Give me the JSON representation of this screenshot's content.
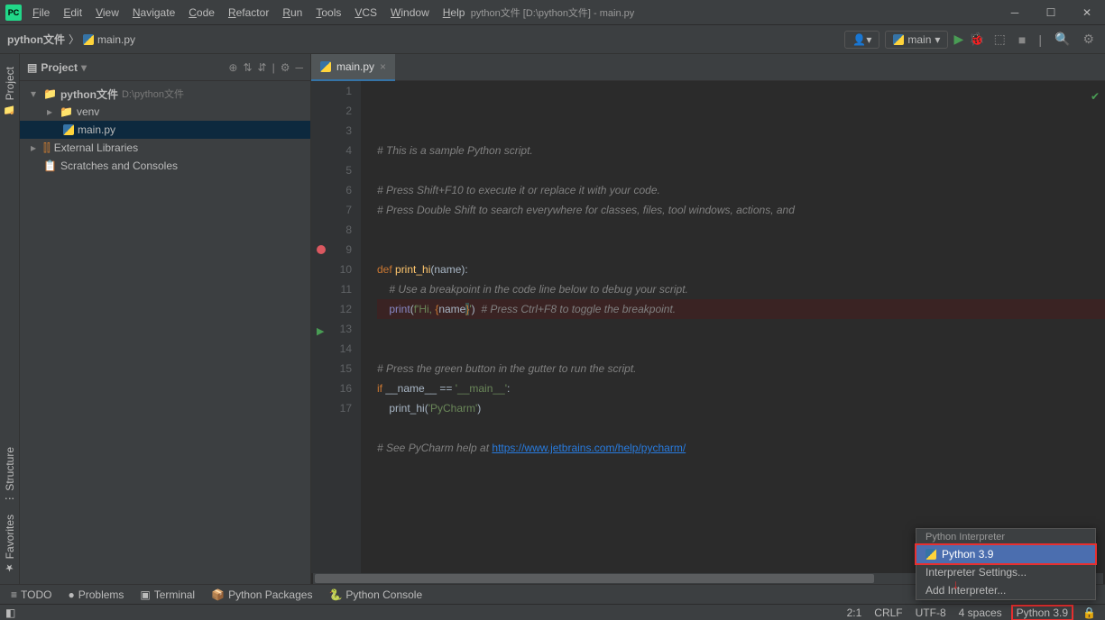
{
  "title": "python文件 [D:\\python文件] - main.py",
  "menu": [
    "File",
    "Edit",
    "View",
    "Navigate",
    "Code",
    "Refactor",
    "Run",
    "Tools",
    "VCS",
    "Window",
    "Help"
  ],
  "breadcrumb": {
    "project": "python文件",
    "file": "main.py"
  },
  "run_config": "main",
  "project_panel": {
    "title": "Project",
    "root": "python文件",
    "root_path": "D:\\python文件",
    "venv": "venv",
    "mainfile": "main.py",
    "external": "External Libraries",
    "scratches": "Scratches and Consoles"
  },
  "tab": {
    "name": "main.py"
  },
  "code": {
    "lines": [
      {
        "n": 1,
        "html": "<span class='cmt'># This is a sample Python script.</span>"
      },
      {
        "n": 2,
        "html": ""
      },
      {
        "n": 3,
        "html": "<span class='cmt'># Press Shift+F10 to execute it or replace it with your code.</span>"
      },
      {
        "n": 4,
        "html": "<span class='cmt'># Press Double Shift to search everywhere for classes, files, tool windows, actions, and </span>"
      },
      {
        "n": 5,
        "html": ""
      },
      {
        "n": 6,
        "html": ""
      },
      {
        "n": 7,
        "html": "<span class='kw'>def </span><span class='fn'>print_hi</span>(name):"
      },
      {
        "n": 8,
        "html": "    <span class='cmt'># Use a breakpoint in the code line below to debug your script.</span>"
      },
      {
        "n": 9,
        "bp": true,
        "html": "    <span class='builtin'>print</span>(<span class='str'>f'Hi, </span><span class='kw'>{</span>name<span class='kw brace-hl'>}</span><span class='str'>'</span>)  <span class='cmt'># Press Ctrl+F8 to toggle the breakpoint.</span>"
      },
      {
        "n": 10,
        "html": ""
      },
      {
        "n": 11,
        "html": ""
      },
      {
        "n": 12,
        "html": "<span class='cmt'># Press the green button in the gutter to run the script.</span>"
      },
      {
        "n": 13,
        "run": true,
        "html": "<span class='kw'>if</span> __name__ == <span class='str'>'__main__'</span>:"
      },
      {
        "n": 14,
        "html": "    print_hi(<span class='str'>'PyCharm'</span>)"
      },
      {
        "n": 15,
        "html": ""
      },
      {
        "n": 16,
        "html": "<span class='cmt'># See PyCharm help at </span><span class='link'>https://www.jetbrains.com/help/pycharm/</span>"
      },
      {
        "n": 17,
        "html": ""
      }
    ]
  },
  "bottom_tools": [
    "TODO",
    "Problems",
    "Terminal",
    "Python Packages",
    "Python Console"
  ],
  "status": {
    "pos": "2:1",
    "eol": "CRLF",
    "enc": "UTF-8",
    "indent": "4 spaces",
    "interpreter": "Python 3.9"
  },
  "popup": {
    "header": "Python Interpreter",
    "selected": "Python 3.9",
    "settings": "Interpreter Settings...",
    "add": "Add Interpreter..."
  },
  "side_tools": {
    "project": "Project",
    "structure": "Structure",
    "favorites": "Favorites"
  }
}
